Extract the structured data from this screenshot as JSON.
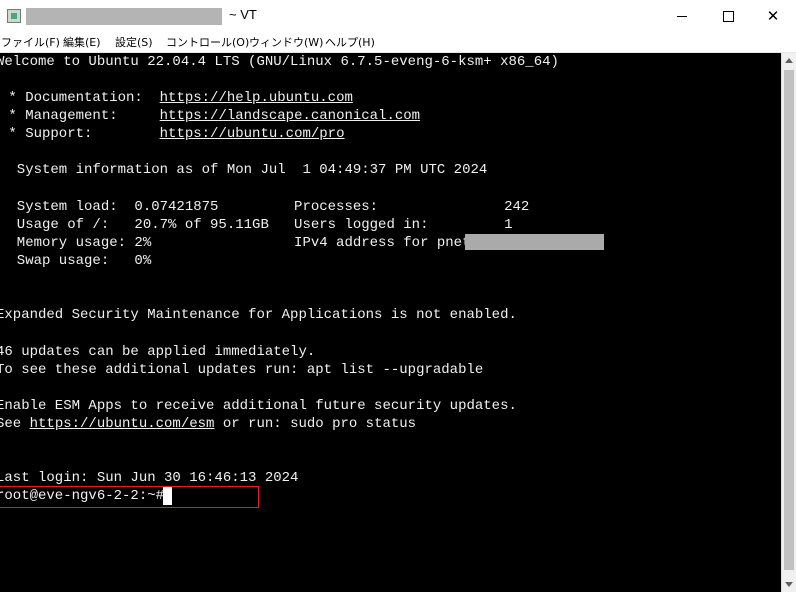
{
  "window": {
    "title": "~ VT"
  },
  "menu": [
    {
      "label": "ファイル(F)"
    },
    {
      "label": "編集(E)"
    },
    {
      "label": "設定(S)"
    },
    {
      "label": "コントロール(O)"
    },
    {
      "label": "ウィンドウ(W)"
    },
    {
      "label": "ヘルプ(H)"
    }
  ],
  "terminal": {
    "welcome": "Welcome to Ubuntu 22.04.4 LTS (GNU/Linux 6.7.5-eveng-6-ksm+ x86_64)",
    "doc_prefix": " * Documentation:  ",
    "doc_url": "https://help.ubuntu.com",
    "mgmt_prefix": " * Management:     ",
    "mgmt_url": "https://landscape.canonical.com",
    "support_prefix": " * Support:        ",
    "support_url": "https://ubuntu.com/pro",
    "sysinfo": "  System information as of Mon Jul  1 04:49:37 PM UTC 2024",
    "stat1": "  System load:  0.07421875         Processes:               242",
    "stat2": "  Usage of /:   20.7% of 95.11GB   Users logged in:         1",
    "stat3": "  Memory usage: 2%                 IPv4 address for pnet0: ",
    "stat4": "  Swap usage:   0%",
    "esm1": "Expanded Security Maintenance for Applications is not enabled.",
    "updates1": "46 updates can be applied immediately.",
    "updates2": "To see these additional updates run: apt list --upgradable",
    "esm2": "Enable ESM Apps to receive additional future security updates.",
    "esm3_prefix": "See ",
    "esm3_url": "https://ubuntu.com/esm",
    "esm3_suffix": " or run: sudo pro status",
    "last_login": "Last login: Sun Jun 30 16:46:13 2024",
    "prompt": "root@eve-ngv6-2-2:~# "
  },
  "colors": {
    "terminal_bg": "#000000",
    "terminal_fg": "#f0f0f0",
    "highlight_box": "#e0201c"
  }
}
